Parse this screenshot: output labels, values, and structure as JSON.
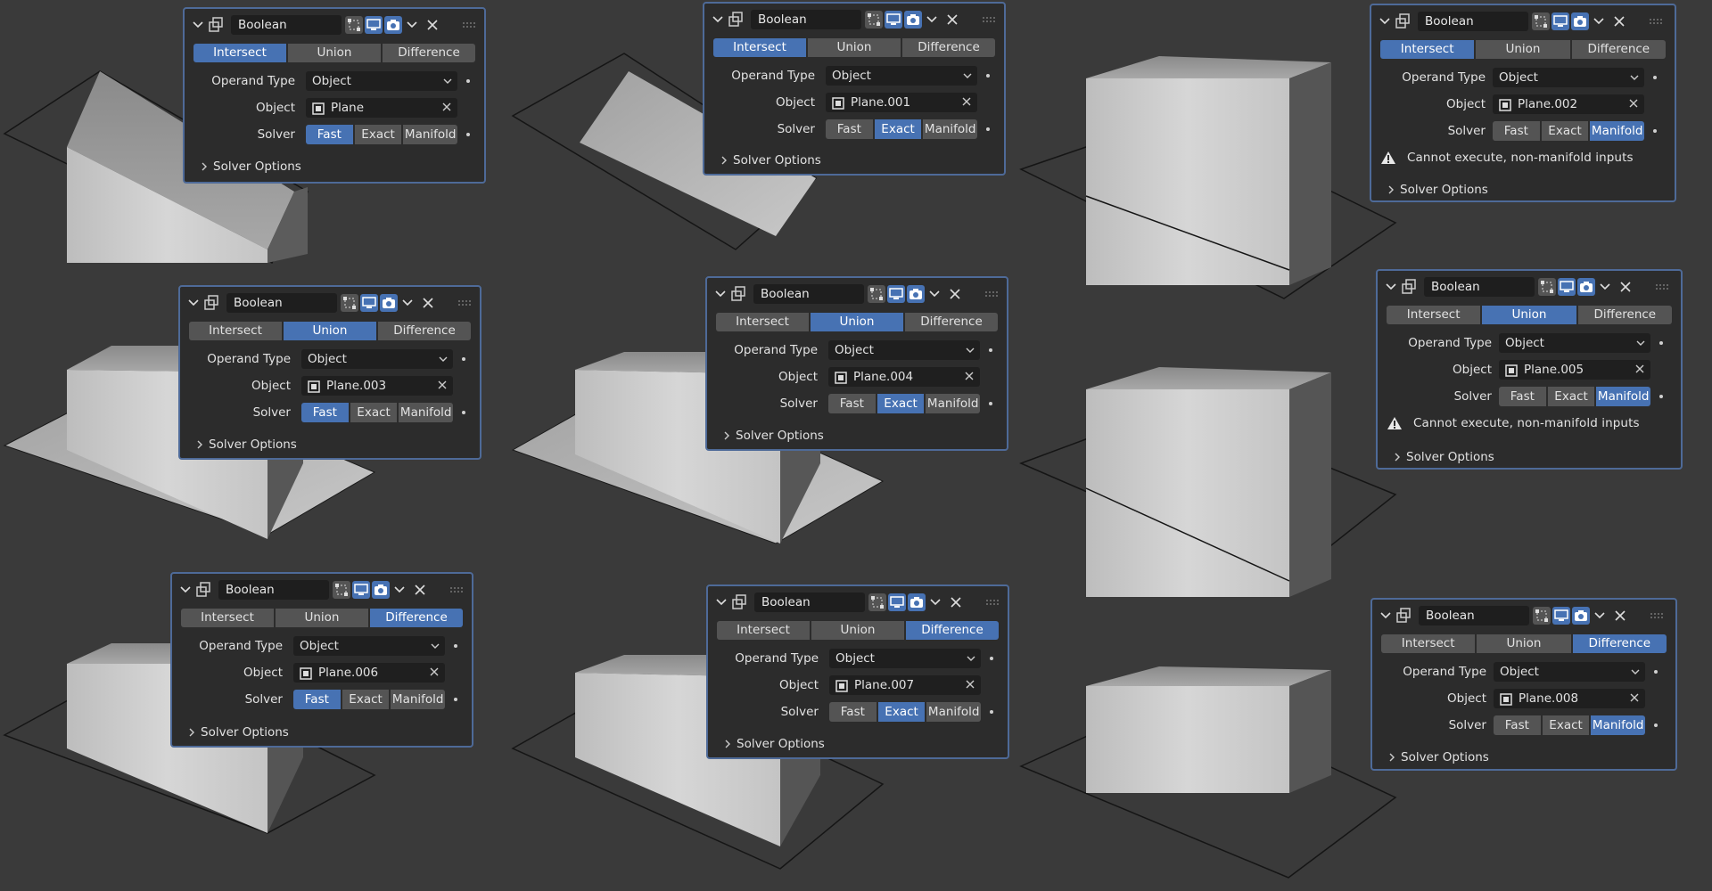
{
  "panels": [
    {
      "name": "Boolean",
      "operations": [
        "Intersect",
        "Union",
        "Difference"
      ],
      "active_operation": "Intersect",
      "operand_label": "Operand Type",
      "operand_value": "Object",
      "object_label": "Object",
      "object_value": "Plane",
      "solver_label": "Solver",
      "solver_options": [
        "Fast",
        "Exact",
        "Manifold"
      ],
      "active_solver": "Fast",
      "warning": "",
      "sub_panel": "Solver Options"
    },
    {
      "name": "Boolean",
      "operations": [
        "Intersect",
        "Union",
        "Difference"
      ],
      "active_operation": "Intersect",
      "operand_label": "Operand Type",
      "operand_value": "Object",
      "object_label": "Object",
      "object_value": "Plane.001",
      "solver_label": "Solver",
      "solver_options": [
        "Fast",
        "Exact",
        "Manifold"
      ],
      "active_solver": "Exact",
      "warning": "",
      "sub_panel": "Solver Options"
    },
    {
      "name": "Boolean",
      "operations": [
        "Intersect",
        "Union",
        "Difference"
      ],
      "active_operation": "Intersect",
      "operand_label": "Operand Type",
      "operand_value": "Object",
      "object_label": "Object",
      "object_value": "Plane.002",
      "solver_label": "Solver",
      "solver_options": [
        "Fast",
        "Exact",
        "Manifold"
      ],
      "active_solver": "Manifold",
      "warning": "Cannot execute, non-manifold inputs",
      "sub_panel": "Solver Options"
    },
    {
      "name": "Boolean",
      "operations": [
        "Intersect",
        "Union",
        "Difference"
      ],
      "active_operation": "Union",
      "operand_label": "Operand Type",
      "operand_value": "Object",
      "object_label": "Object",
      "object_value": "Plane.003",
      "solver_label": "Solver",
      "solver_options": [
        "Fast",
        "Exact",
        "Manifold"
      ],
      "active_solver": "Fast",
      "warning": "",
      "sub_panel": "Solver Options"
    },
    {
      "name": "Boolean",
      "operations": [
        "Intersect",
        "Union",
        "Difference"
      ],
      "active_operation": "Union",
      "operand_label": "Operand Type",
      "operand_value": "Object",
      "object_label": "Object",
      "object_value": "Plane.004",
      "solver_label": "Solver",
      "solver_options": [
        "Fast",
        "Exact",
        "Manifold"
      ],
      "active_solver": "Exact",
      "warning": "",
      "sub_panel": "Solver Options"
    },
    {
      "name": "Boolean",
      "operations": [
        "Intersect",
        "Union",
        "Difference"
      ],
      "active_operation": "Union",
      "operand_label": "Operand Type",
      "operand_value": "Object",
      "object_label": "Object",
      "object_value": "Plane.005",
      "solver_label": "Solver",
      "solver_options": [
        "Fast",
        "Exact",
        "Manifold"
      ],
      "active_solver": "Manifold",
      "warning": "Cannot execute, non-manifold inputs",
      "sub_panel": "Solver Options"
    },
    {
      "name": "Boolean",
      "operations": [
        "Intersect",
        "Union",
        "Difference"
      ],
      "active_operation": "Difference",
      "operand_label": "Operand Type",
      "operand_value": "Object",
      "object_label": "Object",
      "object_value": "Plane.006",
      "solver_label": "Solver",
      "solver_options": [
        "Fast",
        "Exact",
        "Manifold"
      ],
      "active_solver": "Fast",
      "warning": "",
      "sub_panel": "Solver Options"
    },
    {
      "name": "Boolean",
      "operations": [
        "Intersect",
        "Union",
        "Difference"
      ],
      "active_operation": "Difference",
      "operand_label": "Operand Type",
      "operand_value": "Object",
      "object_label": "Object",
      "object_value": "Plane.007",
      "solver_label": "Solver",
      "solver_options": [
        "Fast",
        "Exact",
        "Manifold"
      ],
      "active_solver": "Exact",
      "warning": "",
      "sub_panel": "Solver Options"
    },
    {
      "name": "Boolean",
      "operations": [
        "Intersect",
        "Union",
        "Difference"
      ],
      "active_operation": "Difference",
      "operand_label": "Operand Type",
      "operand_value": "Object",
      "object_label": "Object",
      "object_value": "Plane.008",
      "solver_label": "Solver",
      "solver_options": [
        "Fast",
        "Exact",
        "Manifold"
      ],
      "active_solver": "Manifold",
      "warning": "",
      "sub_panel": "Solver Options"
    }
  ],
  "colors": {
    "background": "#3a3a3a",
    "panel": "#2c2c2c",
    "panel_border": "#4e6a98",
    "accent": "#4772b3",
    "button": "#545454",
    "field": "#1f1f1f"
  }
}
